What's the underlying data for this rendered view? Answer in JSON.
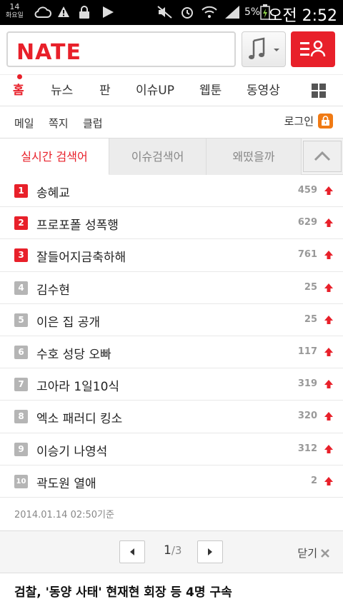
{
  "status_bar": {
    "date_day": "14",
    "date_weekday": "화요일",
    "battery_percent": "5%",
    "time": "오전 2:52",
    "icons": [
      "cloud-icon",
      "alert-icon",
      "lock-icon",
      "play-icon",
      "mute-icon",
      "alarm-icon",
      "wifi-icon",
      "signal-icon",
      "battery-icon"
    ]
  },
  "header": {
    "logo": "NATE",
    "search_placeholder": "",
    "music_icon": "music-note-icon",
    "menu_icon": "menu-person-icon",
    "brand_color": "#e8202a"
  },
  "nav": {
    "items": [
      "홈",
      "뉴스",
      "판",
      "이슈UP",
      "웹툰",
      "동영상"
    ],
    "active": "홈"
  },
  "subnav": {
    "items": [
      "메일",
      "쪽지",
      "클럽"
    ],
    "login": "로그인"
  },
  "keyword_tabs": {
    "tabs": [
      "실시간 검색어",
      "이슈검색어",
      "왜떴을까"
    ],
    "active": "실시간 검색어"
  },
  "ranking": [
    {
      "rank": "1",
      "keyword": "송혜교",
      "count": "459"
    },
    {
      "rank": "2",
      "keyword": "프로포폴 성폭행",
      "count": "629"
    },
    {
      "rank": "3",
      "keyword": "잘들어지금축하해",
      "count": "761"
    },
    {
      "rank": "4",
      "keyword": "김수현",
      "count": "25"
    },
    {
      "rank": "5",
      "keyword": "이은 집 공개",
      "count": "25"
    },
    {
      "rank": "6",
      "keyword": "수호 성당 오빠",
      "count": "117"
    },
    {
      "rank": "7",
      "keyword": "고아라 1일10식",
      "count": "319"
    },
    {
      "rank": "8",
      "keyword": "엑소 패러디 킹소",
      "count": "320"
    },
    {
      "rank": "9",
      "keyword": "이승기 나영석",
      "count": "312"
    },
    {
      "rank": "10",
      "keyword": "곽도원 열애",
      "count": "2"
    }
  ],
  "timestamp": "2014.01.14 02:50기준",
  "pager": {
    "current": "1",
    "total": "/3",
    "close_label": "닫기"
  },
  "headline": "검찰, '동양 사태' 현재현 회장 등 4명 구속"
}
